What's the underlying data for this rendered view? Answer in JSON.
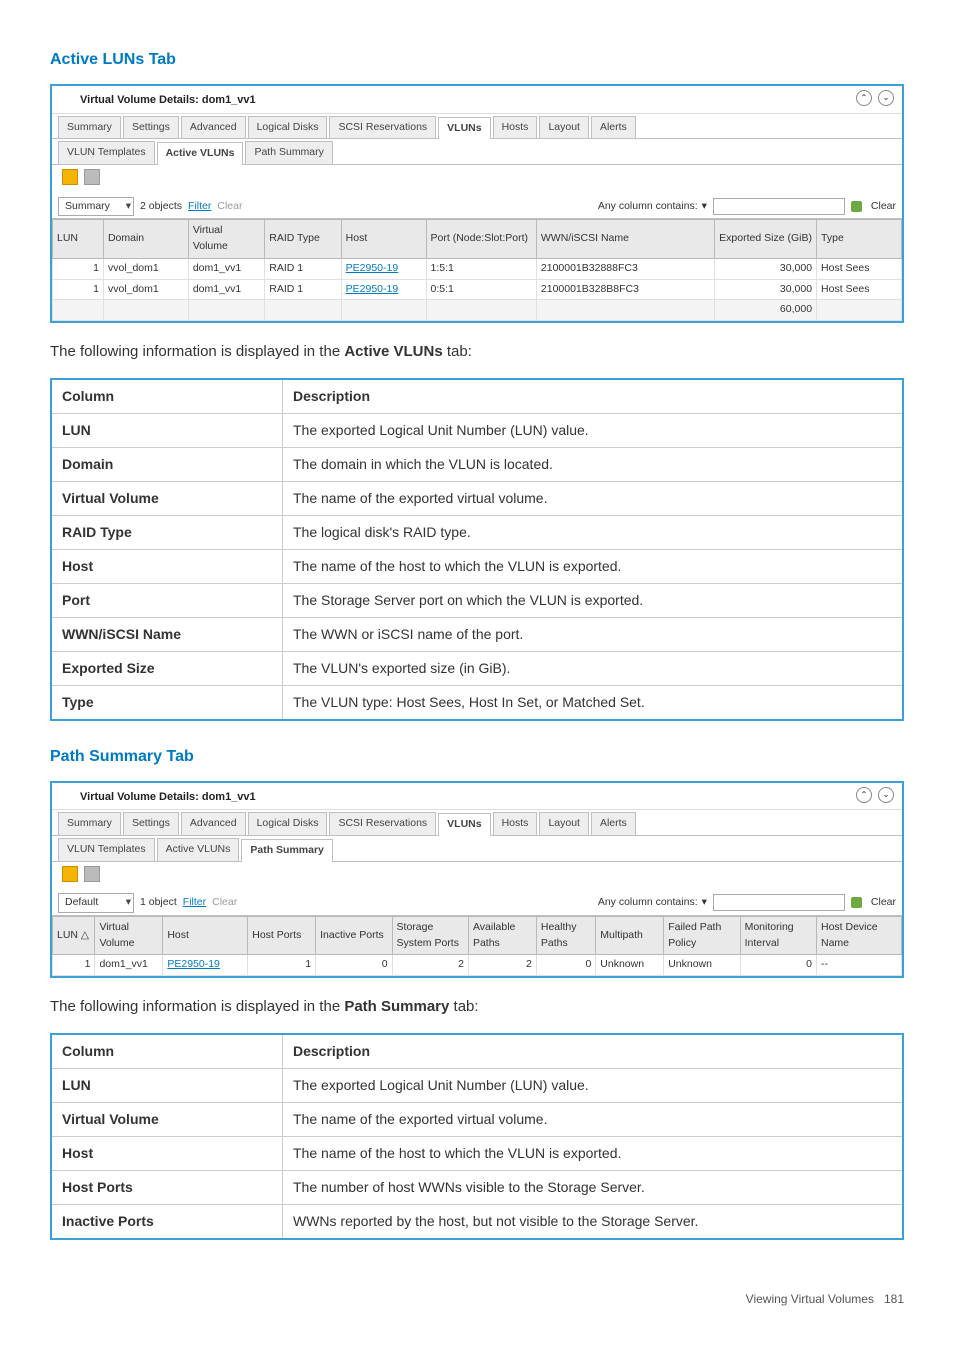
{
  "section1": {
    "heading": "Active LUNs Tab",
    "panel": {
      "title": "Virtual Volume Details: dom1_vv1",
      "tabs": [
        "Summary",
        "Settings",
        "Advanced",
        "Logical Disks",
        "SCSI Reservations",
        "VLUNs",
        "Hosts",
        "Layout",
        "Alerts"
      ],
      "activeTab": "VLUNs",
      "subtabs": [
        "VLUN Templates",
        "Active VLUNs",
        "Path Summary"
      ],
      "activeSubtab": "Active VLUNs",
      "combo": "Summary",
      "objects": "2 objects",
      "filter": "Filter",
      "clear": "Clear",
      "anycol": "Any column contains:",
      "pin": "pin",
      "clear2": "Clear",
      "columns": [
        "LUN",
        "Domain",
        "Virtual Volume",
        "RAID Type",
        "Host",
        "Port (Node:Slot:Port)",
        "WWN/iSCSI Name",
        "Exported Size (GiB)",
        "Type"
      ],
      "rows": [
        {
          "lun": "1",
          "domain": "vvol_dom1",
          "vv": "dom1_vv1",
          "raid": "RAID 1",
          "host": "PE2950-19",
          "port": "1:5:1",
          "wwn": "2100001B32888FC3",
          "size": "30,000",
          "type": "Host Sees"
        },
        {
          "lun": "1",
          "domain": "vvol_dom1",
          "vv": "dom1_vv1",
          "raid": "RAID 1",
          "host": "PE2950-19",
          "port": "0:5:1",
          "wwn": "2100001B328B8FC3",
          "size": "30,000",
          "type": "Host Sees"
        }
      ],
      "total": "60,000"
    },
    "introPre": "The following information is displayed in the ",
    "introBold": "Active VLUNs",
    "introPost": " tab:",
    "desc": [
      [
        "Column",
        "Description"
      ],
      [
        "LUN",
        "The exported Logical Unit Number (LUN) value."
      ],
      [
        "Domain",
        "The domain in which the VLUN is located."
      ],
      [
        "Virtual Volume",
        "The name of the exported virtual volume."
      ],
      [
        "RAID Type",
        "The logical disk's RAID type."
      ],
      [
        "Host",
        "The name of the host to which the VLUN is exported."
      ],
      [
        "Port",
        "The Storage Server port on which the VLUN is exported."
      ],
      [
        "WWN/iSCSI Name",
        "The WWN or iSCSI name of the port."
      ],
      [
        "Exported Size",
        "The VLUN's exported size (in GiB)."
      ],
      [
        "Type",
        "The VLUN type: Host Sees, Host In Set, or Matched Set."
      ]
    ]
  },
  "section2": {
    "heading": "Path Summary Tab",
    "panel": {
      "title": "Virtual Volume Details: dom1_vv1",
      "tabs": [
        "Summary",
        "Settings",
        "Advanced",
        "Logical Disks",
        "SCSI Reservations",
        "VLUNs",
        "Hosts",
        "Layout",
        "Alerts"
      ],
      "activeTab": "VLUNs",
      "subtabs": [
        "VLUN Templates",
        "Active VLUNs",
        "Path Summary"
      ],
      "activeSubtab": "Path Summary",
      "combo": "Default",
      "objects": "1 object",
      "filter": "Filter",
      "clear": "Clear",
      "anycol": "Any column contains:",
      "clear2": "Clear",
      "columns": [
        "LUN",
        "Virtual Volume",
        "Host",
        "Host Ports",
        "Inactive Ports",
        "Storage System Ports",
        "Available Paths",
        "Healthy Paths",
        "Multipath",
        "Failed Path Policy",
        "Monitoring Interval",
        "Host Device Name"
      ],
      "rows": [
        {
          "lun": "1",
          "vv": "dom1_vv1",
          "host": "PE2950-19",
          "hp": "1",
          "ip": "0",
          "ssp": "2",
          "ap": "2",
          "healthy": "0",
          "mp": "Unknown",
          "fpp": "Unknown",
          "mi": "0",
          "hdn": "--"
        }
      ]
    },
    "introPre": "The following information is displayed in the ",
    "introBold": "Path Summary",
    "introPost": " tab:",
    "desc": [
      [
        "Column",
        "Description"
      ],
      [
        "LUN",
        "The exported Logical Unit Number (LUN) value."
      ],
      [
        "Virtual Volume",
        "The name of the exported virtual volume."
      ],
      [
        "Host",
        "The name of the host to which the VLUN is exported."
      ],
      [
        "Host Ports",
        "The number of host WWNs visible to the Storage Server."
      ],
      [
        "Inactive Ports",
        "WWNs reported by the host, but not visible to the Storage Server."
      ]
    ]
  },
  "footer": {
    "label": "Viewing Virtual Volumes",
    "page": "181"
  }
}
